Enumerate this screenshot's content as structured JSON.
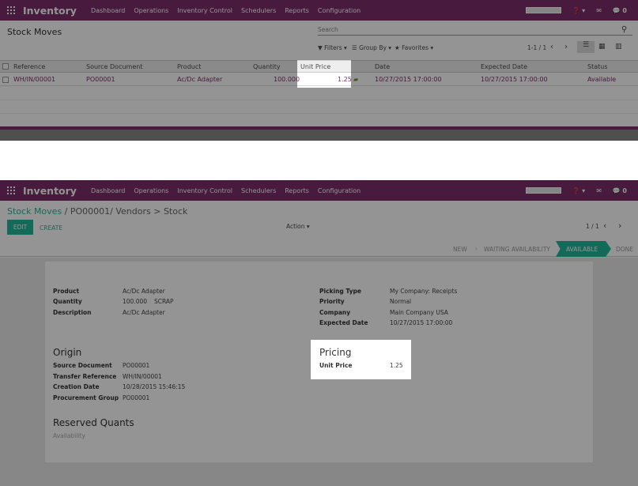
{
  "top_nav": {
    "brand": "Inventory",
    "menu": [
      "Dashboard",
      "Operations",
      "Inventory Control",
      "Schedulers",
      "Reports",
      "Configuration"
    ],
    "help": "❓ ▾",
    "msg_count": "0"
  },
  "list_view": {
    "title": "Stock Moves",
    "search_placeholder": "Search",
    "filters": "Filters",
    "group_by": "Group By",
    "favorites": "Favorites",
    "pager": "1-1 / 1",
    "columns": [
      "Reference",
      "Source Document",
      "Product",
      "Quantity",
      "Unit Price",
      "Date",
      "Expected Date",
      "Status"
    ],
    "row": {
      "reference": "WH/IN/00001",
      "source": "PO00001",
      "product": "Ac/Dc Adapter",
      "quantity": "100.000",
      "unit_price": "1.25",
      "date": "10/27/2015 17:00:00",
      "expected": "10/27/2015 17:00:00",
      "status": "Available"
    }
  },
  "form_view": {
    "breadcrumb_root": "Stock Moves",
    "breadcrumb_current": "PO00001/ Vendors > Stock",
    "edit": "EDIT",
    "create": "CREATE",
    "action": "Action",
    "pager": "1 / 1",
    "stages": [
      "NEW",
      "WAITING AVAILABILITY",
      "AVAILABLE",
      "DONE"
    ],
    "active_stage": "AVAILABLE",
    "fields_left": [
      {
        "label": "Product",
        "value": "Ac/Dc Adapter"
      },
      {
        "label": "Quantity",
        "value": "100.000"
      },
      {
        "label": "Description",
        "value": "Ac/Dc Adapter"
      }
    ],
    "scrap": "SCRAP",
    "fields_right": [
      {
        "label": "Picking Type",
        "value": "My Company: Receipts"
      },
      {
        "label": "Priority",
        "value": "Normal"
      },
      {
        "label": "Company",
        "value": "Main Company USA"
      },
      {
        "label": "Expected Date",
        "value": "10/27/2015 17:00:00"
      }
    ],
    "origin_title": "Origin",
    "origin_fields": [
      {
        "label": "Source Document",
        "value": "PO00001"
      },
      {
        "label": "Transfer Reference",
        "value": "WH/IN/00001"
      },
      {
        "label": "Creation Date",
        "value": "10/28/2015 15:46:15"
      },
      {
        "label": "Procurement Group",
        "value": "PO00001"
      }
    ],
    "pricing_title": "Pricing",
    "unit_price_label": "Unit Price",
    "unit_price_value": "1.25",
    "reserved_title": "Reserved Quants",
    "availability": "Availability"
  }
}
